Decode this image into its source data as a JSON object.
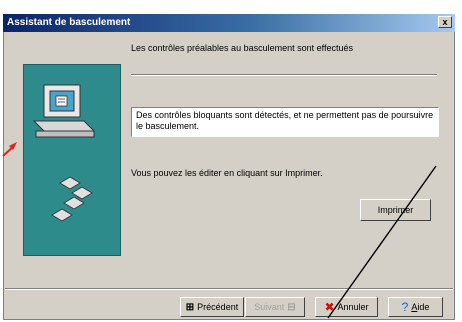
{
  "window": {
    "title": "Assistant de basculement",
    "close_glyph": "x"
  },
  "content": {
    "header": "Les contrôles préalables au basculement sont effectués",
    "message": "Des contrôles bloquants sont détectés, et ne permettent pas de poursuivre le basculement.",
    "info": "Vous pouvez les éditer en cliquant sur Imprimer."
  },
  "buttons": {
    "print": "Imprimer",
    "previous": "Précédent",
    "next": "Suivant",
    "cancel": "Annuler",
    "help_prefix": "",
    "help_underlined": "A",
    "help_rest": "ide"
  },
  "icons": {
    "computer": "computer-icon",
    "disks": "floppy-disks-icon",
    "previous": "previous-icon",
    "next": "next-icon",
    "cancel": "cancel-icon",
    "help": "help-icon"
  },
  "annotation_color": "#e0201a"
}
